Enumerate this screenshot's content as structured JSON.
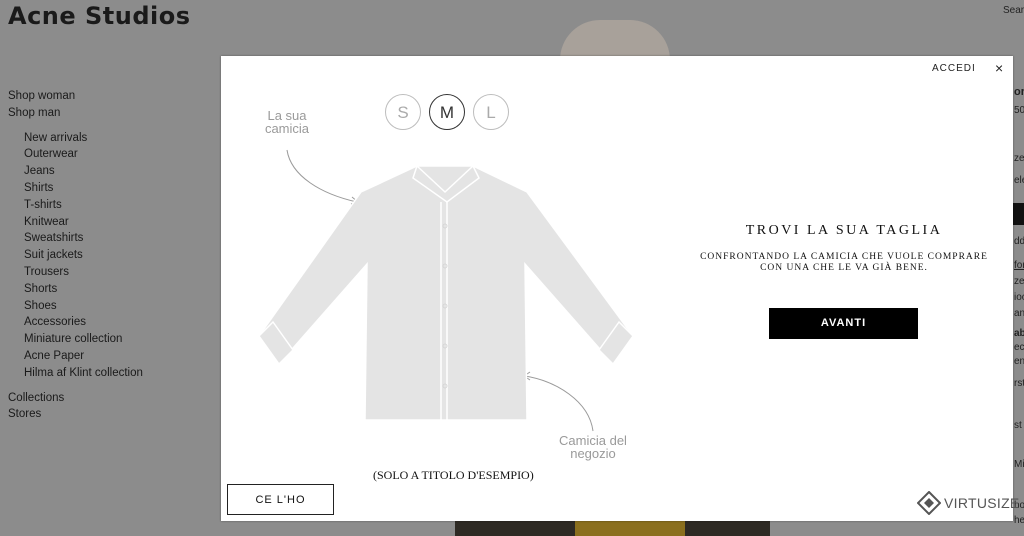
{
  "site": {
    "logo": "Acne Studios",
    "search_label": "Sear"
  },
  "nav": {
    "top": [
      "Shop woman",
      "Shop man"
    ],
    "sub": [
      "New arrivals",
      "Outerwear",
      "Jeans",
      "Shirts",
      "T-shirts",
      "Knitwear",
      "Sweatshirts",
      "Suit jackets",
      "Trousers",
      "Shorts",
      "Shoes",
      "Accessories",
      "Miniature collection",
      "Acne Paper",
      "Hilma af Klint collection"
    ],
    "bottom": [
      "Collections",
      "Stores"
    ]
  },
  "right_edge": [
    "or",
    "50",
    "ze",
    "ele",
    "dd",
    "for",
    "ze",
    "ioo",
    "an",
    "ab",
    "ec",
    "en",
    "rst",
    "st",
    "Mi",
    "ho",
    "hel"
  ],
  "modal": {
    "login_label": "ACCEDI",
    "close_label": "×",
    "sizes": [
      "S",
      "M",
      "L"
    ],
    "selected_size": "M",
    "label_your_shirt": "La sua camicia",
    "label_store_shirt": "Camicia del negozio",
    "example_note": "(SOLO A TITOLO D'ESEMPIO)",
    "have_button": "CE L'HO",
    "title": "TROVI LA SUA TAGLIA",
    "subtitle": "CONFRONTANDO LA CAMICIA CHE VUOLE COMPRARE CON UNA CHE LE VA GIÀ BENE.",
    "next_button": "AVANTI",
    "brand": "VIRTUSIZE"
  }
}
